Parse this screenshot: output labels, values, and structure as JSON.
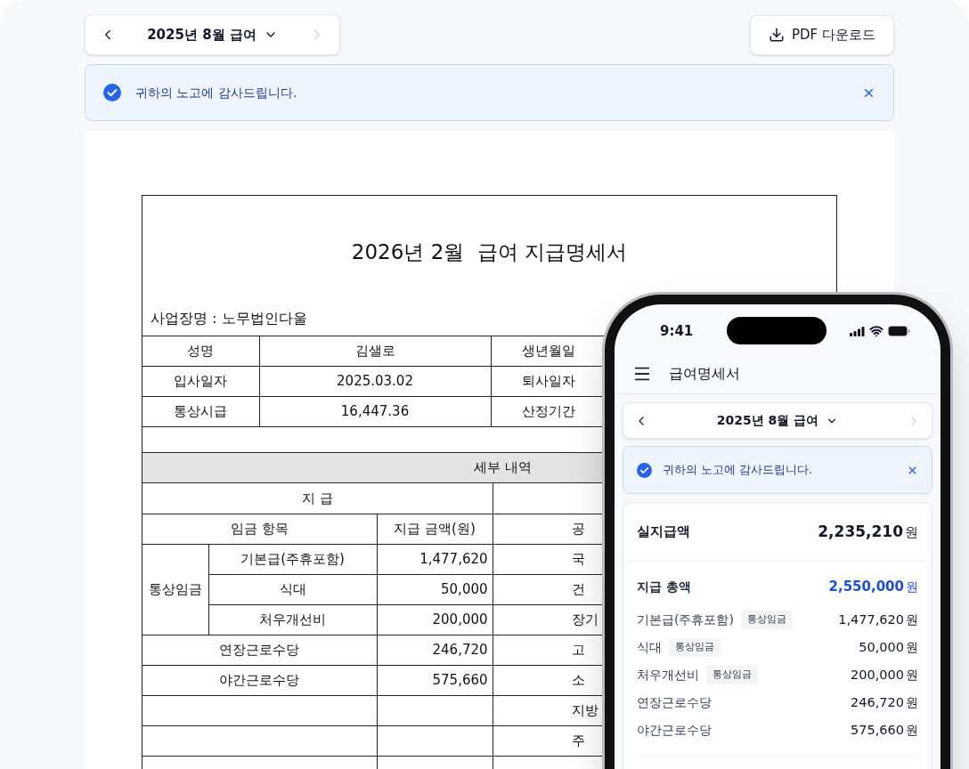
{
  "toolbar": {
    "month_label": "2025년 8월 급여",
    "prev_disabled": false,
    "next_disabled": true,
    "download_button": "PDF 다운로드"
  },
  "alert": {
    "message": "귀하의 노고에 감사드립니다."
  },
  "document": {
    "title": "2026년 2월  급여 지급명세서",
    "workplace": "사업장명 : 노무법인다울",
    "info_rows": [
      [
        "성명",
        "김샐로",
        "생년월일"
      ],
      [
        "입사일자",
        "2025.03.02",
        "퇴사일자"
      ],
      [
        "통상시급",
        "16,447.36",
        "산정기간"
      ]
    ],
    "section_header": "세부 내역",
    "payment_heading": "지 급",
    "columns": [
      "임금 항목",
      "지급 금액(원)",
      "공"
    ],
    "ordinary_wage_label": "통상임금",
    "ordinary_items": [
      {
        "name": "기본급(주휴포함)",
        "amount": "1,477,620",
        "deduction": "국"
      },
      {
        "name": "식대",
        "amount": "50,000",
        "deduction": "건"
      },
      {
        "name": "처우개선비",
        "amount": "200,000",
        "deduction": "장기"
      }
    ],
    "other_items": [
      {
        "name": "연장근로수당",
        "amount": "246,720",
        "deduction": "고"
      },
      {
        "name": "야간근로수당",
        "amount": "575,660",
        "deduction": "소"
      },
      {
        "deduction": "지방"
      },
      {
        "deduction": "주"
      }
    ]
  },
  "phone": {
    "time": "9:41",
    "title": "급여명세서",
    "month_label": "2025년 8월 급여",
    "prev_disabled": false,
    "next_disabled": true,
    "alert": "귀하의 노고에 감사드립니다.",
    "net_pay": {
      "label": "실지급액",
      "amount": "2,235,210",
      "unit": "원"
    },
    "gross": {
      "label": "지급 총액",
      "amount": "2,550,000",
      "unit": "원"
    },
    "items": [
      {
        "name": "기본급(주휴포함)",
        "tag": "통상임금",
        "amount": "1,477,620",
        "unit": "원"
      },
      {
        "name": "식대",
        "tag": "통상임금",
        "amount": "50,000",
        "unit": "원"
      },
      {
        "name": "처우개선비",
        "tag": "통상임금",
        "amount": "200,000",
        "unit": "원"
      },
      {
        "name": "연장근로수당",
        "amount": "246,720",
        "unit": "원"
      },
      {
        "name": "야간근로수당",
        "amount": "575,660",
        "unit": "원"
      }
    ]
  }
}
